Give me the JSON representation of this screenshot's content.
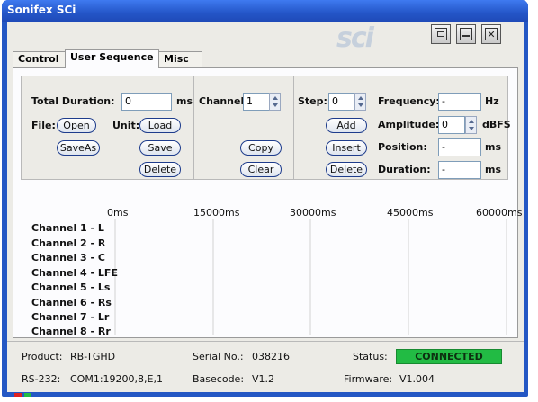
{
  "window": {
    "title": "Sonifex SCi",
    "logo_text": "sci",
    "buttons": [
      "minimize",
      "restore",
      "close"
    ]
  },
  "tabs": [
    {
      "label": "Control",
      "active": false
    },
    {
      "label": "User Sequence",
      "active": true
    },
    {
      "label": "Misc",
      "active": false
    }
  ],
  "sequence": {
    "total_duration_label": "Total Duration:",
    "total_duration_value": "0",
    "total_duration_unit": "ms",
    "file_label": "File:",
    "open_label": "Open",
    "saveas_label": "SaveAs",
    "unit_label": "Unit:",
    "load_label": "Load",
    "save_label": "Save",
    "delete_label": "Delete",
    "channel_label": "Channel:",
    "channel_value": "1",
    "copy_label": "Copy",
    "clear_label": "Clear",
    "step_label": "Step:",
    "step_value": "0",
    "add_label": "Add",
    "insert_label": "Insert",
    "step_delete_label": "Delete",
    "frequency_label": "Frequency:",
    "frequency_value": "-",
    "frequency_unit": "Hz",
    "amplitude_label": "Amplitude:",
    "amplitude_value": "0",
    "amplitude_unit": "dBFS",
    "position_label": "Position:",
    "position_value": "-",
    "position_unit": "ms",
    "duration_label": "Duration:",
    "duration_value": "-",
    "duration_unit": "ms"
  },
  "timeline": {
    "ticks": [
      "0ms",
      "15000ms",
      "30000ms",
      "45000ms",
      "60000ms"
    ],
    "channels": [
      "Channel 1 - L",
      "Channel 2 - R",
      "Channel 3 - C",
      "Channel 4 - LFE",
      "Channel 5 - Ls",
      "Channel 6 - Rs",
      "Channel 7 - Lr",
      "Channel 8 - Rr"
    ]
  },
  "status": {
    "product_label": "Product:",
    "product_value": "RB-TGHD",
    "serial_label": "Serial No.:",
    "serial_value": "038216",
    "status_label": "Status:",
    "status_value": "CONNECTED",
    "rs232_label": "RS-232:",
    "rs232_value": "COM1:19200,8,E,1",
    "basecode_label": "Basecode:",
    "basecode_value": "V1.2",
    "firmware_label": "Firmware:",
    "firmware_value": "V1.004"
  },
  "colors": {
    "titlebar": "#2457c4",
    "connected": "#22bb44",
    "lamp_red": "#dd2222",
    "lamp_green": "#22bb44"
  }
}
